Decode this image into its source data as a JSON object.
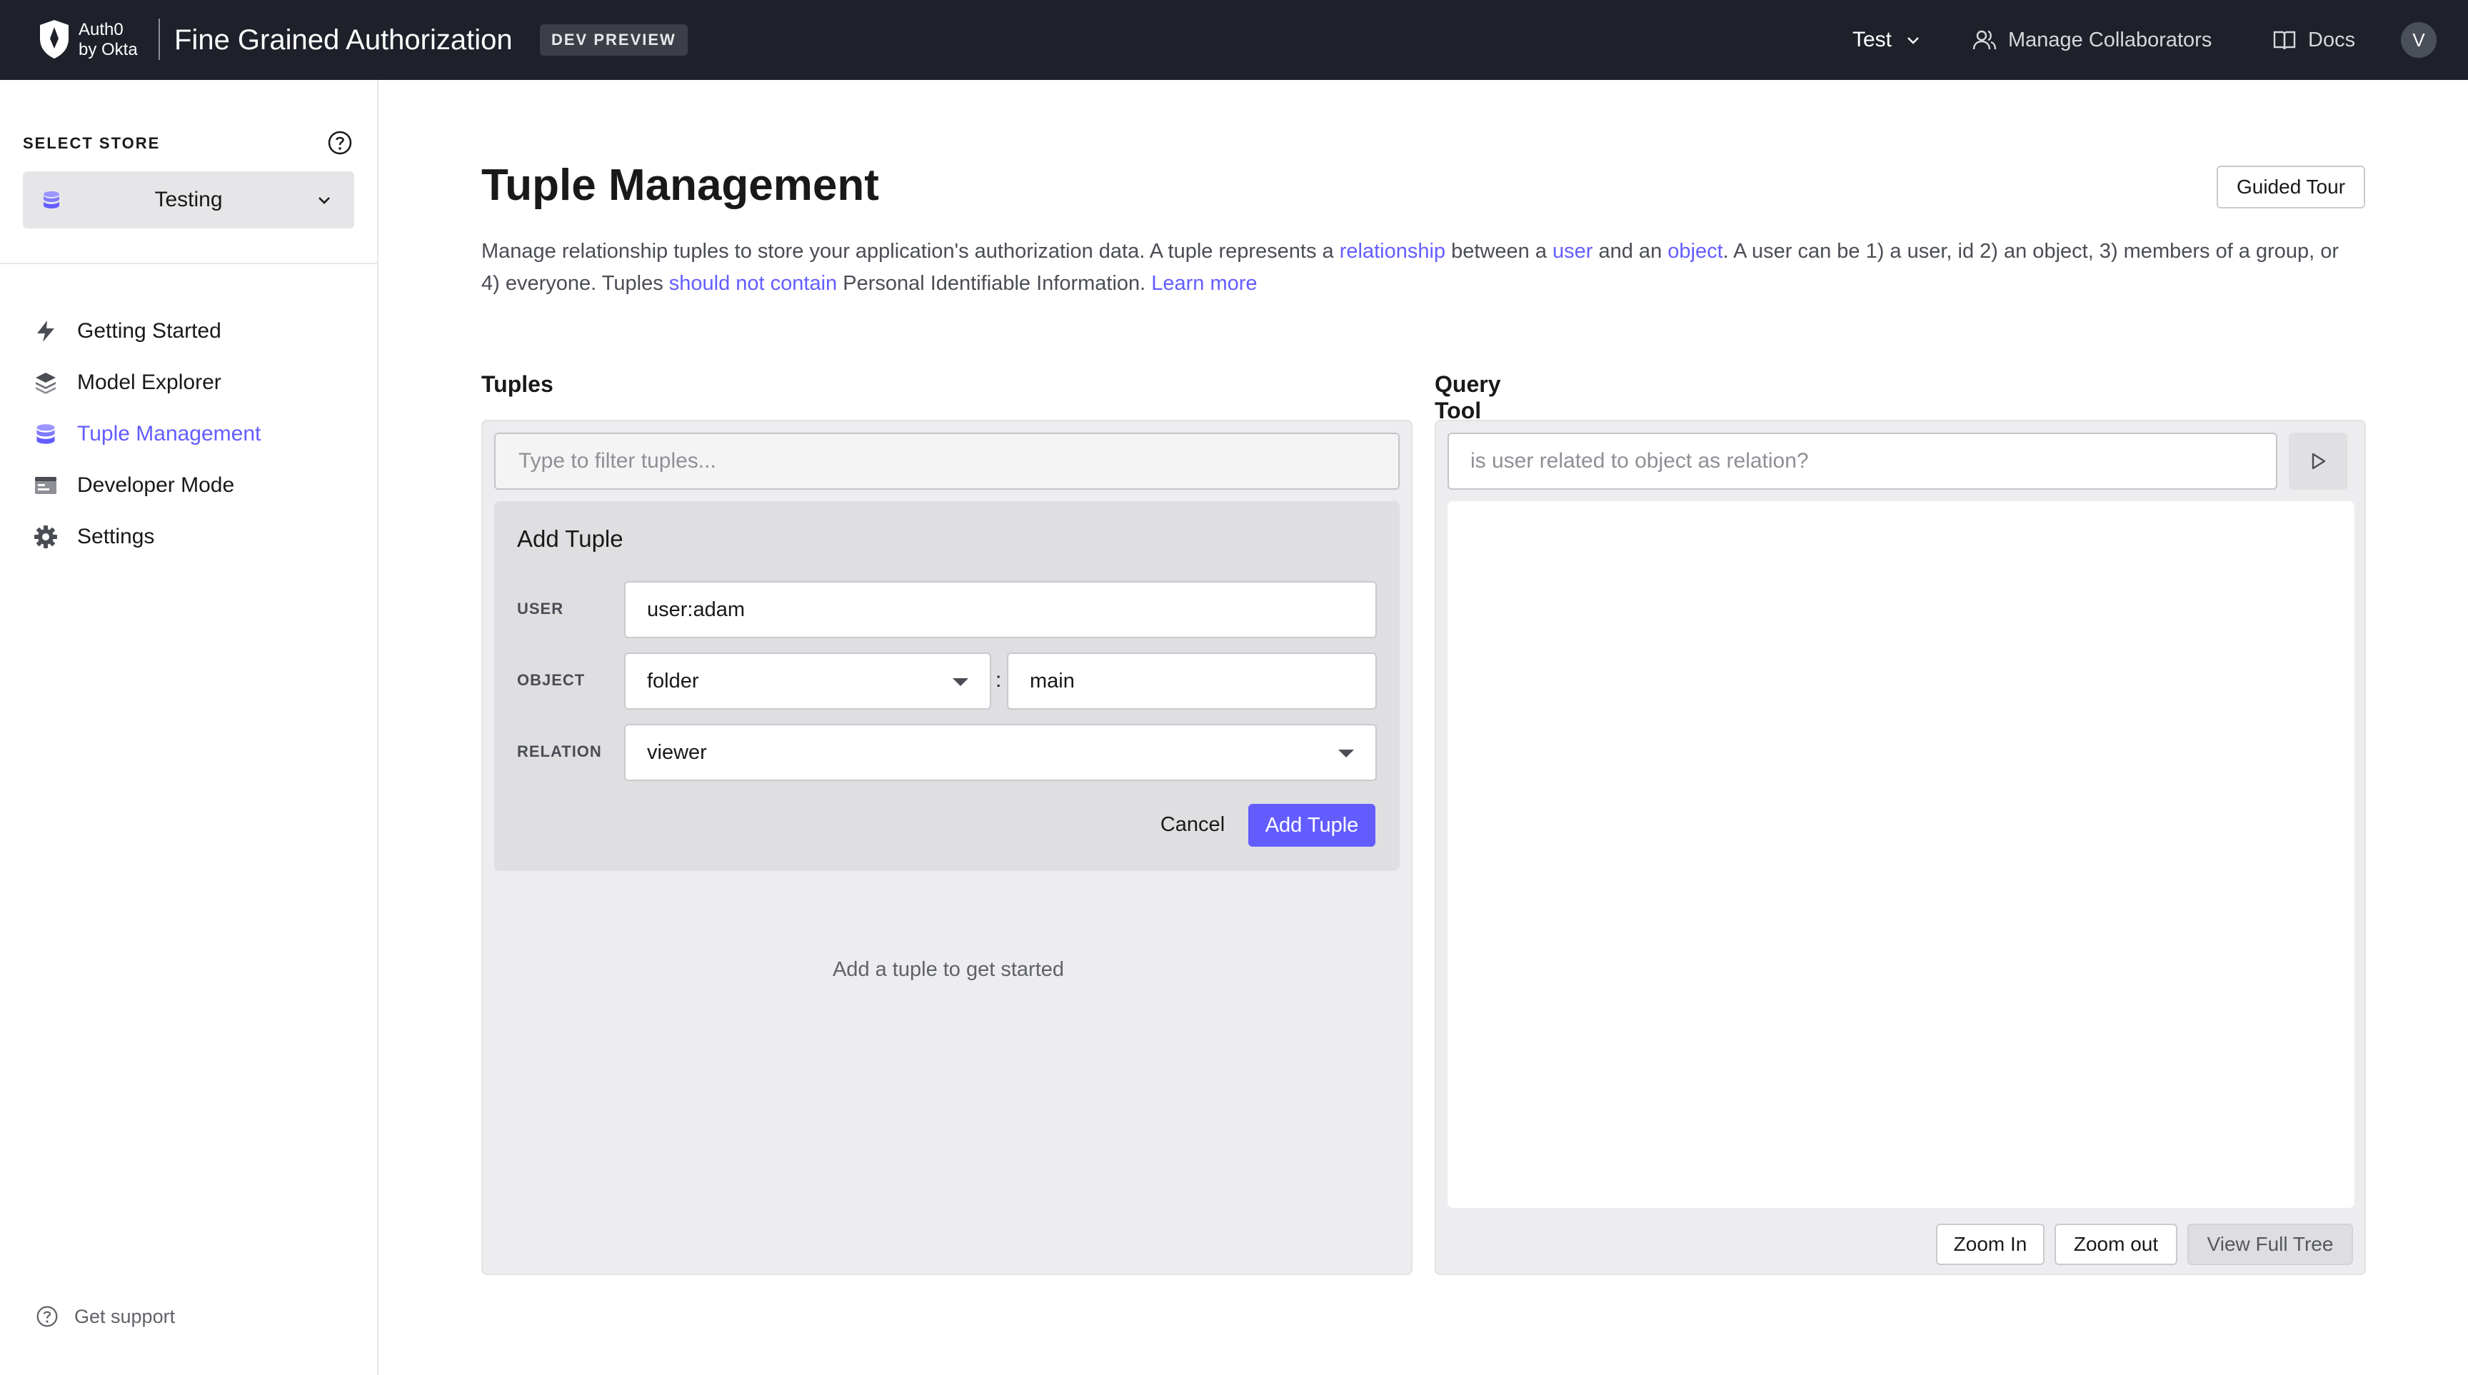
{
  "header": {
    "logo_text_line1": "Auth0",
    "logo_text_line2": "by Okta",
    "app_title": "Fine Grained Authorization",
    "badge": "DEV PREVIEW",
    "tenant": "Test",
    "manage_collaborators": "Manage Collaborators",
    "docs": "Docs",
    "avatar_initial": "V",
    "icons": [
      "auth0-shield-icon",
      "chevron-down-icon",
      "users-icon",
      "book-icon"
    ]
  },
  "sidebar": {
    "select_store_label": "SELECT STORE",
    "store_name": "Testing",
    "items": [
      {
        "label": "Getting Started",
        "icon": "bolt-icon",
        "active": false
      },
      {
        "label": "Model Explorer",
        "icon": "layers-icon",
        "active": false
      },
      {
        "label": "Tuple Management",
        "icon": "database-icon",
        "active": true
      },
      {
        "label": "Developer Mode",
        "icon": "terminal-window-icon",
        "active": false
      },
      {
        "label": "Settings",
        "icon": "gear-icon",
        "active": false
      }
    ],
    "support": "Get support"
  },
  "page": {
    "title": "Tuple Management",
    "guided_tour": "Guided Tour",
    "description": {
      "p1": "Manage relationship tuples to store your application's authorization data. A tuple represents a ",
      "link_relationship": "relationship",
      "p2": " between a ",
      "link_user": "user",
      "p3": " and an ",
      "link_object": "object",
      "p4": ". A user can be 1) a user, id 2) an object, 3) members of a group, or 4) everyone. Tuples ",
      "link_should_not_contain": "should not contain",
      "p5": " Personal Identifiable Information. ",
      "link_learn_more": "Learn more"
    }
  },
  "tuples": {
    "title": "Tuples",
    "filter_placeholder": "Type to filter tuples...",
    "add_card": {
      "title": "Add Tuple",
      "user_label": "USER",
      "user_value": "user:adam",
      "object_label": "OBJECT",
      "object_type": "folder",
      "object_id": "main",
      "relation_label": "RELATION",
      "relation_value": "viewer",
      "cancel": "Cancel",
      "submit": "Add Tuple"
    },
    "empty_message": "Add a tuple to get started"
  },
  "query": {
    "title": "Query Tool",
    "placeholder": "is user related to object as relation?",
    "zoom_in": "Zoom In",
    "zoom_out": "Zoom out",
    "view_full_tree": "View Full Tree"
  },
  "colors": {
    "accent": "#635dff",
    "topbar": "#1e212a"
  }
}
